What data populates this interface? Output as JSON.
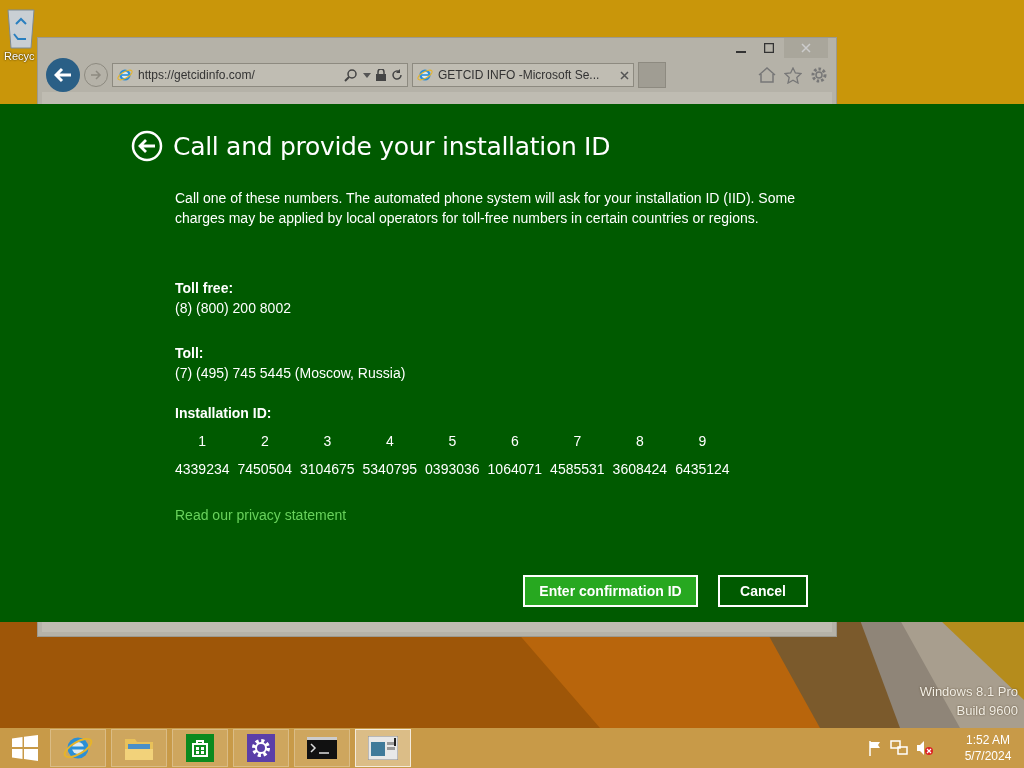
{
  "desktop": {
    "icons": [
      {
        "label": "Recyc"
      }
    ],
    "watermark": [
      "Windows 8.1 Pro",
      "Build 9600"
    ]
  },
  "browser": {
    "address": "https://getcidinfo.com/",
    "tabs": [
      {
        "title": "GETCID INFO -Microsoft Se...",
        "selected": true
      }
    ]
  },
  "dialog": {
    "title": "Call and provide your installation ID",
    "description": "Call one of these numbers. The automated phone system will ask for your installation ID (IID). Some charges may be applied by local operators for toll-free numbers in certain countries or regions.",
    "contacts": [
      {
        "label": "Toll free:",
        "number": "(8) (800) 200 8002"
      },
      {
        "label": "Toll:",
        "number": "(7) (495) 745 5445 (Moscow, Russia)"
      }
    ],
    "installation_id": {
      "label": "Installation ID:",
      "groups": [
        {
          "index": "1",
          "value": "4339234"
        },
        {
          "index": "2",
          "value": "7450504"
        },
        {
          "index": "3",
          "value": "3104675"
        },
        {
          "index": "4",
          "value": "5340795"
        },
        {
          "index": "5",
          "value": "0393036"
        },
        {
          "index": "6",
          "value": "1064071"
        },
        {
          "index": "7",
          "value": "4585531"
        },
        {
          "index": "8",
          "value": "3608424"
        },
        {
          "index": "9",
          "value": "6435124"
        }
      ]
    },
    "privacy_link": "Read our privacy statement",
    "buttons": [
      {
        "label": "Enter confirmation ID",
        "kind": "primary"
      },
      {
        "label": "Cancel",
        "kind": "secondary"
      }
    ]
  },
  "taskbar": {
    "apps": [
      {
        "kind": "ie",
        "active": false
      },
      {
        "kind": "explorer",
        "active": false
      },
      {
        "kind": "store",
        "active": false
      },
      {
        "kind": "settings",
        "active": false
      },
      {
        "kind": "console",
        "active": false
      },
      {
        "kind": "window",
        "active": true
      }
    ],
    "clock": {
      "time": "1:52 AM",
      "date": "5/7/2024"
    }
  }
}
